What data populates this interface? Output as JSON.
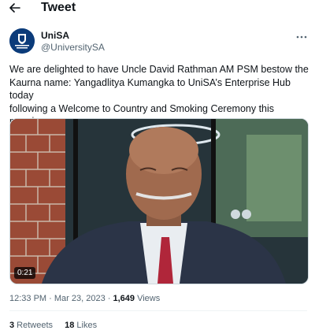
{
  "header": {
    "title": "Tweet"
  },
  "author": {
    "name": "UniSA",
    "handle": "@UniversitySA",
    "avatar_text": "University of South Australia"
  },
  "tweet": {
    "text": "We are delighted to have Uncle David Rathman AM PSM bestow the\nKaurna name: Yangadlitya Kumangka to UniSA’s Enterprise Hub today\nfollowing a Welcome to Country and Smoking Ceremony this morning, as\nthe building opens today!"
  },
  "media": {
    "duration": "0:21"
  },
  "meta": {
    "time": "12:33 PM",
    "separator": " · ",
    "date": "Mar 23, 2023",
    "views_count": "1,649",
    "views_label": " Views"
  },
  "stats": {
    "retweets_count": "3",
    "retweets_label": " Retweets",
    "likes_count": "18",
    "likes_label": " Likes"
  },
  "colors": {
    "accent": "#0b3b7a",
    "muted": "#536471",
    "text": "#0f1419"
  },
  "icons": {
    "back": "arrow-left-icon",
    "more": "more-horizontal-icon"
  }
}
